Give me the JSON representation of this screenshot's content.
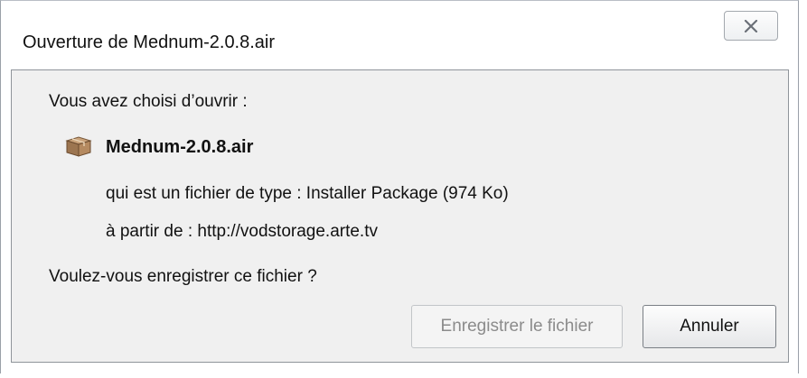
{
  "window": {
    "title": "Ouverture de Mednum-2.0.8.air",
    "close_icon": "close-icon"
  },
  "dialog": {
    "prompt": "Vous avez choisi d’ouvrir :",
    "file_icon": "package-icon",
    "file_name": "Mednum-2.0.8.air",
    "type_line": "qui est un fichier de type : Installer Package (974 Ko)",
    "from_line": "à partir de : http://vodstorage.arte.tv",
    "question": "Voulez-vous enregistrer ce fichier ?"
  },
  "buttons": {
    "save_label": "Enregistrer le fichier",
    "save_enabled": false,
    "cancel_label": "Annuler"
  }
}
